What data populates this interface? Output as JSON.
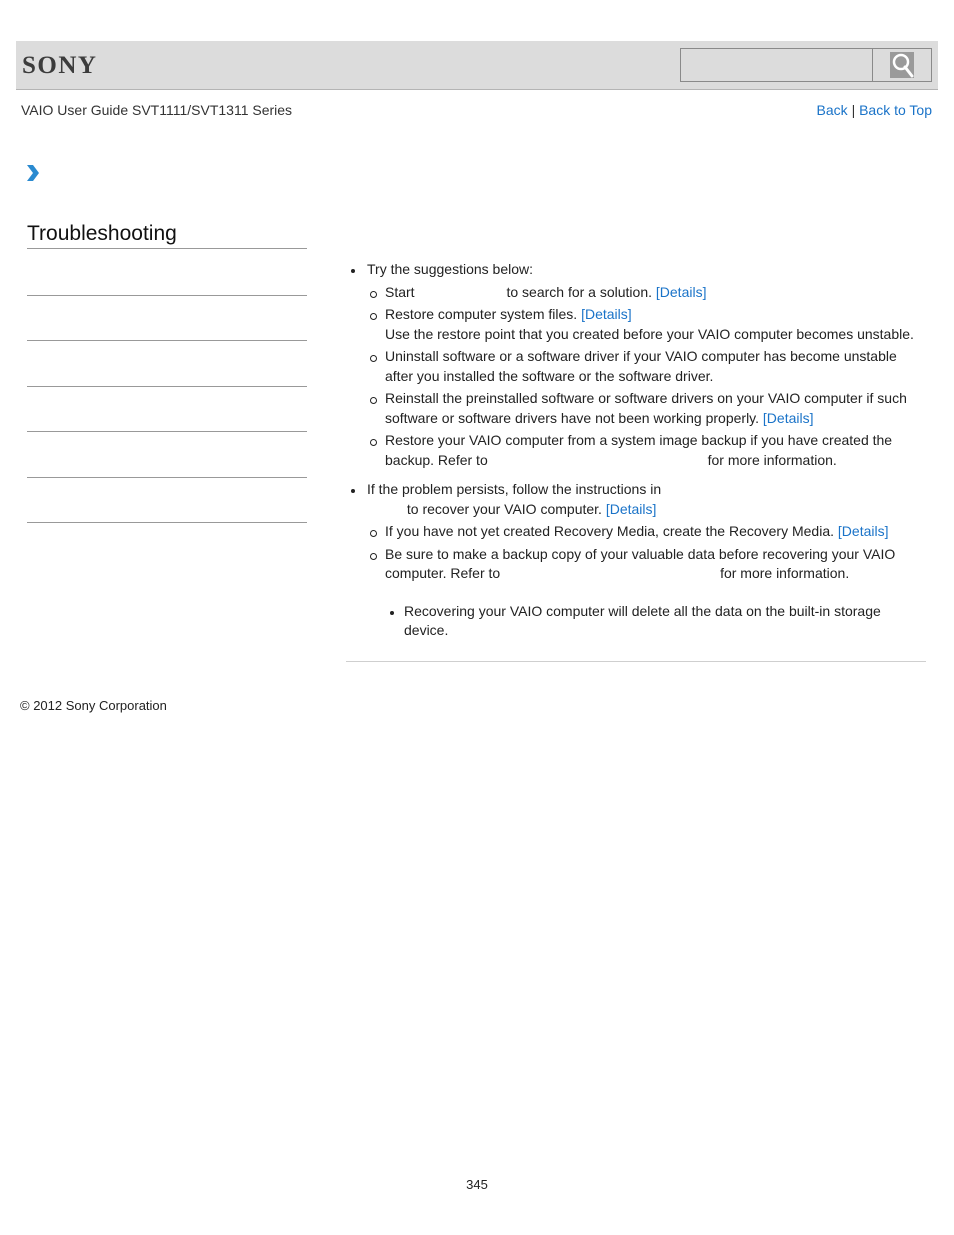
{
  "header": {
    "logo": "SONY",
    "search": {
      "placeholder": "",
      "value": "",
      "button_icon": "search-icon"
    }
  },
  "nav": {
    "guide_title": "VAIO User Guide SVT1111/SVT1311 Series",
    "back_label": "Back",
    "separator": "|",
    "back_to_top_label": "Back to Top",
    "breadcrumb_icon": "chevron-right-icon"
  },
  "sidebar": {
    "title": "Troubleshooting",
    "item_count": 6
  },
  "content": {
    "items": [
      {
        "text": "Try the suggestions below:",
        "subitems": [
          {
            "before": "Start",
            "after": "to search for a solution.",
            "link": "[Details]"
          },
          {
            "before": "Restore computer system files.",
            "link": "[Details]",
            "extra": "Use the restore point that you created before your VAIO computer becomes unstable."
          },
          {
            "before": "Uninstall software or a software driver if your VAIO computer has become unstable after you installed the software or the software driver."
          },
          {
            "before": "Reinstall the preinstalled software or software drivers on your VAIO computer if such software or software drivers have not been working properly.",
            "link": "[Details]"
          },
          {
            "before": "Restore your VAIO computer from a system image backup if you have created the backup. Refer to",
            "after": "for more information."
          }
        ]
      },
      {
        "text": "If the problem persists, follow the instructions in",
        "text_after": "to recover your VAIO computer.",
        "link": "[Details]",
        "subitems": [
          {
            "before": "If you have not yet created Recovery Media, create the Recovery Media.",
            "link": "[Details]"
          },
          {
            "before": "Be sure to make a backup copy of your valuable data before recovering your VAIO computer. Refer to",
            "after": "for more information."
          }
        ],
        "note": "Recovering your VAIO computer will delete all the data on the built-in storage device."
      }
    ]
  },
  "footer": {
    "copyright": "© 2012 Sony Corporation",
    "page_number": "345"
  },
  "colors": {
    "link": "#1a73c8",
    "header_bg": "#dcdcdc",
    "chevron": "#2a8ad0"
  }
}
